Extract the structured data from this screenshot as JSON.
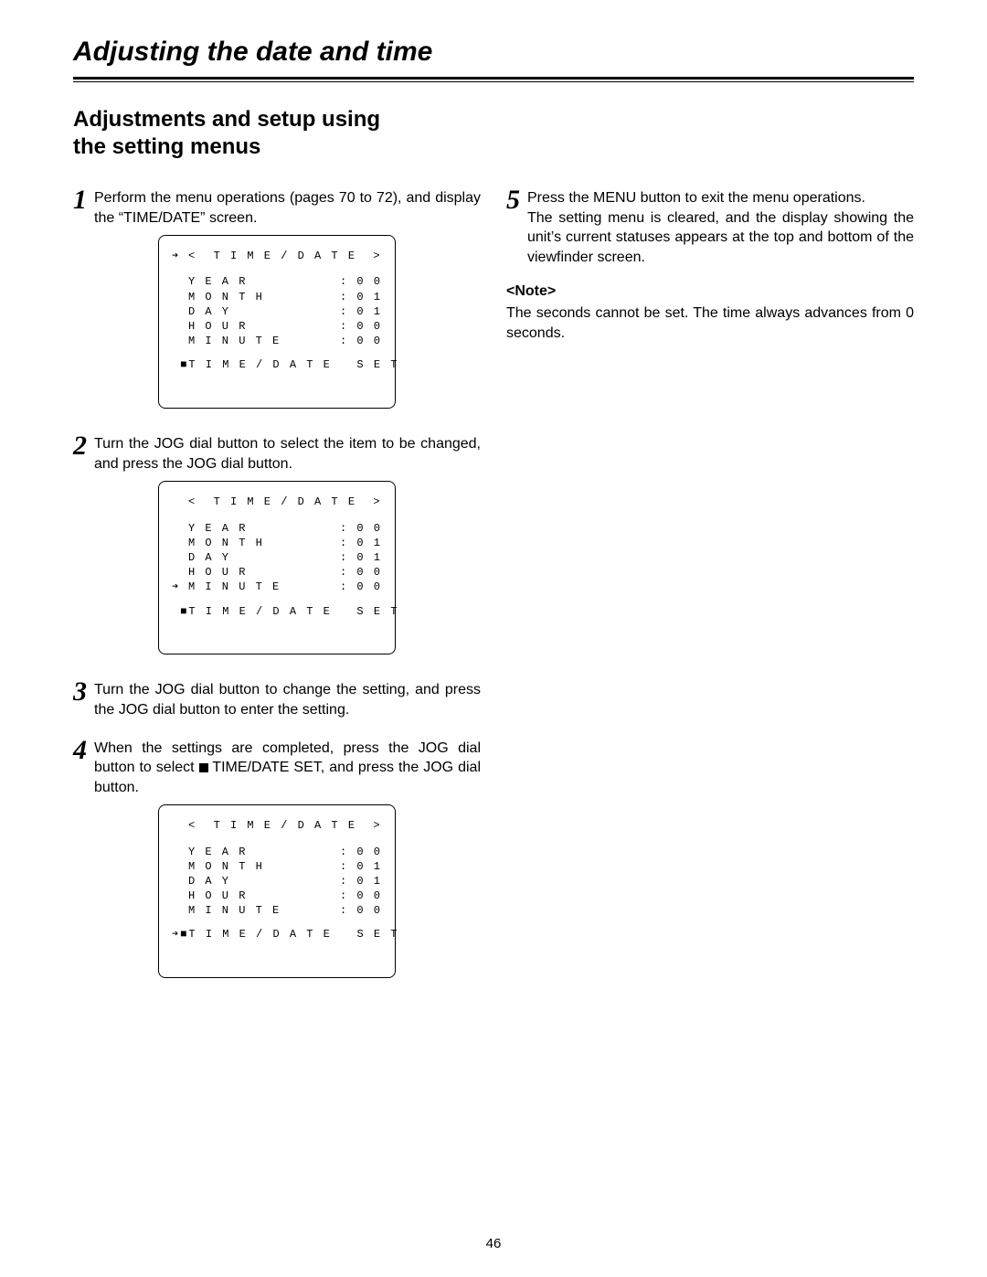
{
  "title": "Adjusting the date and time",
  "subtitle_l1": "Adjustments and setup using",
  "subtitle_l2": "the setting menus",
  "steps": {
    "s1": {
      "num": "1",
      "text": "Perform the menu operations (pages 70 to 72), and display the “TIME/DATE” screen."
    },
    "s2": {
      "num": "2",
      "text": "Turn the JOG dial button to select the item to be changed, and press the JOG dial button."
    },
    "s3": {
      "num": "3",
      "text": "Turn the JOG dial button to change the setting, and press the JOG dial button to enter the setting."
    },
    "s4": {
      "num": "4",
      "pre": "When the settings are completed, press the JOG dial button to select ",
      "mid": " TIME/DATE SET, and press the JOG dial button."
    },
    "s5": {
      "num": "5",
      "text": "Press the MENU button to exit the menu operations.",
      "extra": "The setting menu is cleared, and the display showing the unit’s current statuses appears at the top and bottom of the viewfinder screen."
    }
  },
  "note": {
    "heading": "<Note>",
    "text": "The seconds cannot be set.  The time always advances from 0 seconds."
  },
  "screens": {
    "title": "<  T I M E / D A T E  >",
    "rows": [
      {
        "label": "YEAR",
        "val": ":00"
      },
      {
        "label": "MONTH",
        "val": ":01"
      },
      {
        "label": "DAY",
        "val": ":01"
      },
      {
        "label": "HOUR",
        "val": ":00"
      },
      {
        "label": "MINUTE",
        "val": ":00"
      }
    ],
    "set": "■TIME/DATE SET",
    "arrow": "➔",
    "cfg": {
      "s1": {
        "titleArrow": true,
        "arrowRow": -1,
        "setArrow": false
      },
      "s2": {
        "titleArrow": false,
        "arrowRow": 4,
        "setArrow": false
      },
      "s4": {
        "titleArrow": false,
        "arrowRow": -1,
        "setArrow": true
      }
    }
  },
  "page_number": "46"
}
